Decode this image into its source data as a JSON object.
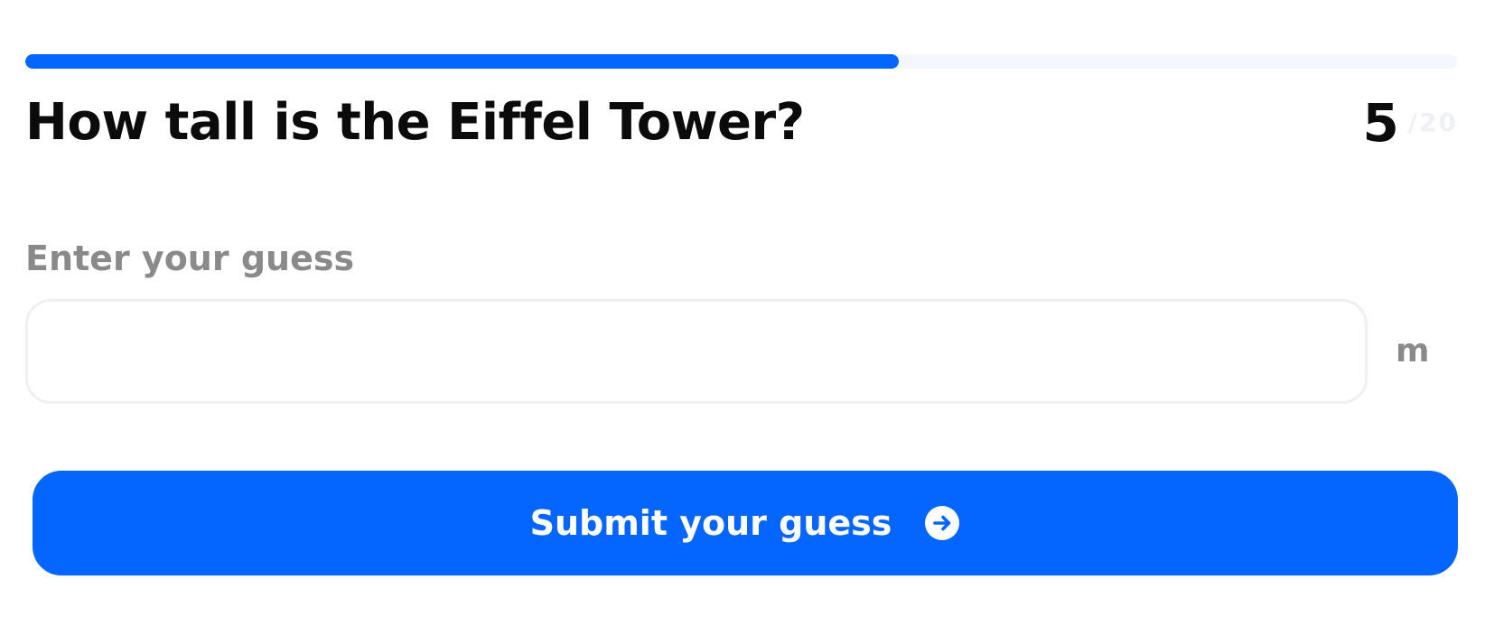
{
  "colors": {
    "accent": "#0565ff",
    "track": "#f4f8fe",
    "text": "#0b0b0b",
    "muted": "#8a8a8a",
    "faint": "#eef0f3"
  },
  "progress": {
    "fraction": 0.61
  },
  "question": {
    "text": "How tall is the Eiffel Tower?"
  },
  "counter": {
    "current": "5",
    "total": "/20"
  },
  "guess": {
    "label": "Enter your guess",
    "value": "",
    "placeholder": "",
    "unit": "m"
  },
  "submit": {
    "label": "Submit your guess",
    "icon": "arrow-right-circle-icon"
  }
}
